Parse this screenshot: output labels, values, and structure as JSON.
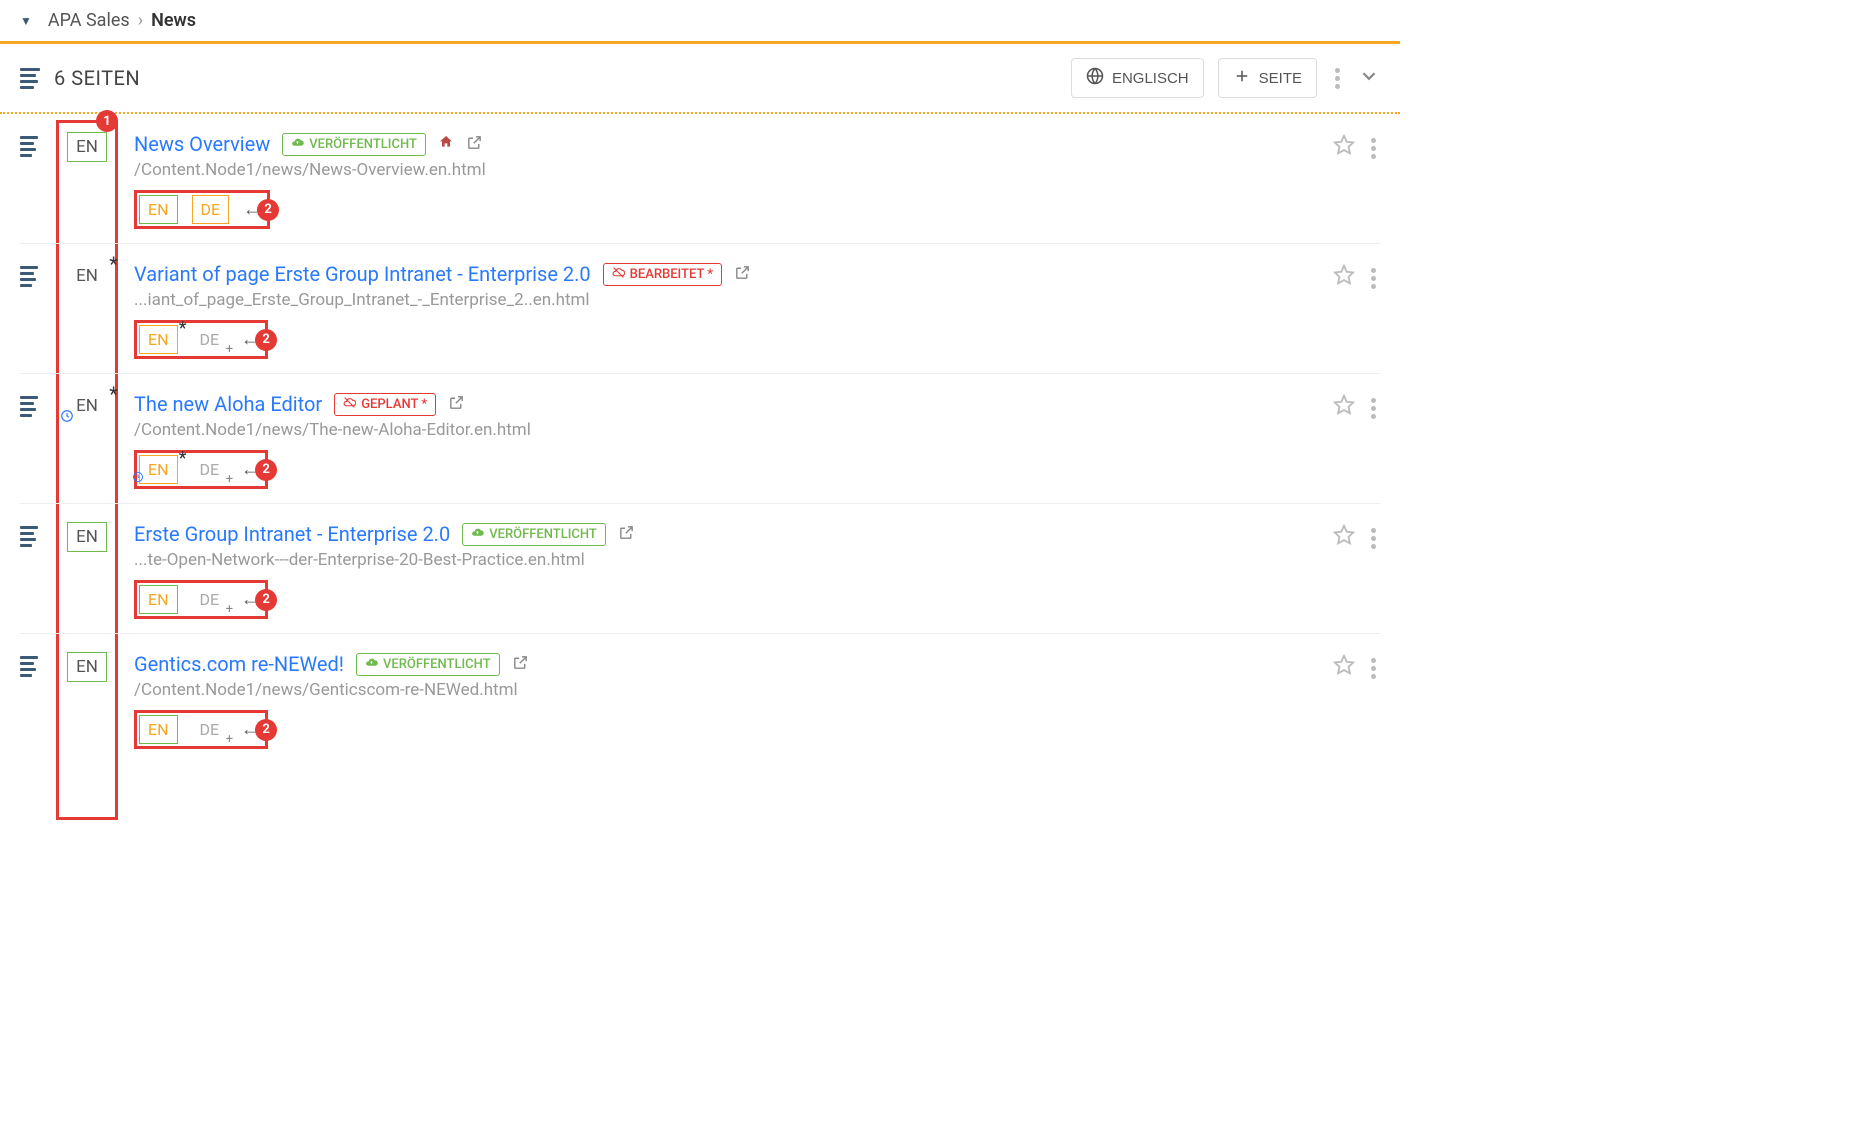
{
  "breadcrumb": {
    "parent": "APA Sales",
    "current": "News"
  },
  "toolbar": {
    "title": "6 SEITEN",
    "lang_button": "ENGLISCH",
    "page_button": "SEITE"
  },
  "annotations": {
    "num1": "1",
    "num2": "2"
  },
  "pages": [
    {
      "lang_main": "EN",
      "lang_main_frame": true,
      "lang_star": false,
      "lang_clock": false,
      "title": "News Overview",
      "badge": {
        "type": "published",
        "text": "VERÖFFENTLICHT"
      },
      "home": true,
      "path": "/Content.Node1/news/News-Overview.en.html",
      "langs": [
        {
          "code": "EN",
          "style": "engreen",
          "star": false,
          "clock": false,
          "plus": false
        },
        {
          "code": "DE",
          "style": "deorange",
          "star": false,
          "clock": false,
          "plus": false
        }
      ]
    },
    {
      "lang_main": "EN",
      "lang_main_frame": false,
      "lang_star": true,
      "lang_clock": false,
      "title": "Variant of page Erste Group Intranet - Enterprise 2.0",
      "badge": {
        "type": "edited",
        "text": "BEARBEITET *"
      },
      "home": false,
      "path": "...iant_of_page_Erste_Group_Intranet_-_Enterprise_2..en.html",
      "langs": [
        {
          "code": "EN",
          "style": "enorange",
          "star": true,
          "clock": false,
          "plus": false
        },
        {
          "code": "DE",
          "style": "deghost",
          "star": false,
          "clock": false,
          "plus": true
        }
      ]
    },
    {
      "lang_main": "EN",
      "lang_main_frame": false,
      "lang_star": true,
      "lang_clock": true,
      "title": "The new Aloha Editor",
      "badge": {
        "type": "planned",
        "text": "GEPLANT *"
      },
      "home": false,
      "path": "/Content.Node1/news/The-new-Aloha-Editor.en.html",
      "langs": [
        {
          "code": "EN",
          "style": "enorange",
          "star": true,
          "clock": true,
          "plus": false
        },
        {
          "code": "DE",
          "style": "deghost",
          "star": false,
          "clock": false,
          "plus": true
        }
      ]
    },
    {
      "lang_main": "EN",
      "lang_main_frame": true,
      "lang_star": false,
      "lang_clock": false,
      "title": "Erste Group Intranet - Enterprise 2.0",
      "badge": {
        "type": "published",
        "text": "VERÖFFENTLICHT"
      },
      "home": false,
      "path": "...te-Open-Network---der-Enterprise-20-Best-Practice.en.html",
      "langs": [
        {
          "code": "EN",
          "style": "engreen",
          "star": false,
          "clock": false,
          "plus": false
        },
        {
          "code": "DE",
          "style": "deghost",
          "star": false,
          "clock": false,
          "plus": true
        }
      ]
    },
    {
      "lang_main": "EN",
      "lang_main_frame": true,
      "lang_star": false,
      "lang_clock": false,
      "title": "Gentics.com re-NEWed!",
      "badge": {
        "type": "published",
        "text": "VERÖFFENTLICHT"
      },
      "home": false,
      "path": "/Content.Node1/news/Genticscom-re-NEWed.html",
      "langs": [
        {
          "code": "EN",
          "style": "engreen",
          "star": false,
          "clock": false,
          "plus": false
        },
        {
          "code": "DE",
          "style": "deghost",
          "star": false,
          "clock": false,
          "plus": true
        }
      ]
    }
  ]
}
